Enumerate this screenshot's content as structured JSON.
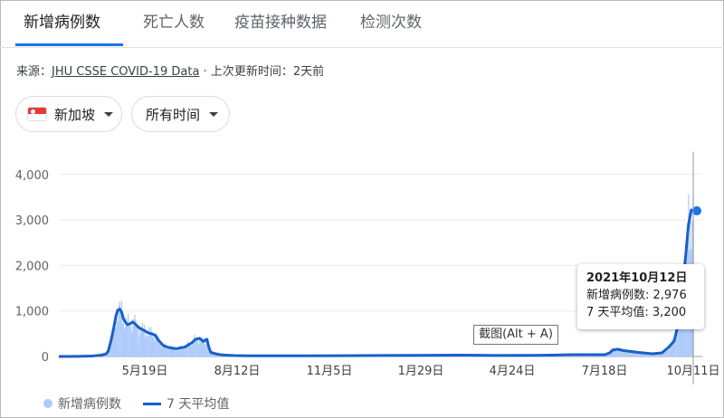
{
  "tabs": [
    {
      "label": "新增病例数",
      "active": true
    },
    {
      "label": "死亡人数",
      "active": false
    },
    {
      "label": "疫苗接种数据",
      "active": false
    },
    {
      "label": "检测次数",
      "active": false
    }
  ],
  "source": {
    "prefix": "来源：",
    "link": "JHU CSSE COVID-19 Data",
    "suffix": " · 上次更新时间：2天前"
  },
  "filters": {
    "region": "新加坡",
    "region_icon": "singapore-flag-icon",
    "time": "所有时间"
  },
  "tooltip": {
    "date": "2021年10月12日",
    "line1": "新增病例数: 2,976",
    "line2": "7 天平均值: 3,200"
  },
  "overlay": {
    "snip_label": "截图(Alt + A)"
  },
  "legend": {
    "bars": "新增病例数",
    "line": "7 天平均值"
  },
  "colors": {
    "accent": "#1a73e8",
    "line": "#1a5fc9",
    "bars": "#aecbfa"
  },
  "chart_data": {
    "type": "bar",
    "y_ticks": [
      "4,000",
      "3,000",
      "2,000",
      "1,000",
      "0"
    ],
    "y_values": [
      4000,
      3000,
      2000,
      1000,
      0
    ],
    "x_ticks": [
      "5月19日",
      "8月12日",
      "11月5日",
      "1月29日",
      "4月24日",
      "7月18日",
      "10月11日"
    ],
    "ylim": [
      0,
      4500
    ],
    "grid": true,
    "legend": "bottom-left",
    "series": [
      {
        "name": "新增病例数",
        "kind": "bar"
      },
      {
        "name": "7 天平均值",
        "kind": "line"
      }
    ],
    "line_points": [
      [
        0,
        0
      ],
      [
        20,
        2
      ],
      [
        35,
        10
      ],
      [
        45,
        30
      ],
      [
        50,
        60
      ],
      [
        52,
        120
      ],
      [
        55,
        350
      ],
      [
        58,
        650
      ],
      [
        60,
        880
      ],
      [
        62,
        1020
      ],
      [
        64,
        1040
      ],
      [
        66,
        980
      ],
      [
        68,
        830
      ],
      [
        70,
        760
      ],
      [
        72,
        700
      ],
      [
        75,
        720
      ],
      [
        78,
        760
      ],
      [
        81,
        700
      ],
      [
        84,
        640
      ],
      [
        87,
        600
      ],
      [
        90,
        570
      ],
      [
        94,
        520
      ],
      [
        98,
        500
      ],
      [
        102,
        460
      ],
      [
        104,
        380
      ],
      [
        107,
        310
      ],
      [
        110,
        240
      ],
      [
        115,
        200
      ],
      [
        120,
        180
      ],
      [
        124,
        170
      ],
      [
        128,
        190
      ],
      [
        132,
        200
      ],
      [
        136,
        250
      ],
      [
        140,
        300
      ],
      [
        144,
        380
      ],
      [
        148,
        400
      ],
      [
        152,
        330
      ],
      [
        156,
        380
      ],
      [
        158,
        200
      ],
      [
        160,
        90
      ],
      [
        165,
        60
      ],
      [
        170,
        40
      ],
      [
        175,
        30
      ],
      [
        185,
        20
      ],
      [
        200,
        15
      ],
      [
        260,
        15
      ],
      [
        300,
        18
      ],
      [
        340,
        22
      ],
      [
        380,
        25
      ],
      [
        420,
        30
      ],
      [
        440,
        28
      ],
      [
        460,
        22
      ],
      [
        500,
        25
      ],
      [
        520,
        30
      ],
      [
        540,
        40
      ],
      [
        560,
        40
      ],
      [
        575,
        40
      ],
      [
        580,
        80
      ],
      [
        583,
        140
      ],
      [
        588,
        160
      ],
      [
        595,
        130
      ],
      [
        610,
        90
      ],
      [
        625,
        60
      ],
      [
        635,
        80
      ],
      [
        642,
        200
      ],
      [
        648,
        340
      ],
      [
        652,
        700
      ],
      [
        656,
        1400
      ],
      [
        660,
        2200
      ],
      [
        663,
        2900
      ],
      [
        666,
        3220
      ],
      [
        668,
        3200
      ]
    ],
    "highlight_point": [
      668,
      3200
    ]
  }
}
